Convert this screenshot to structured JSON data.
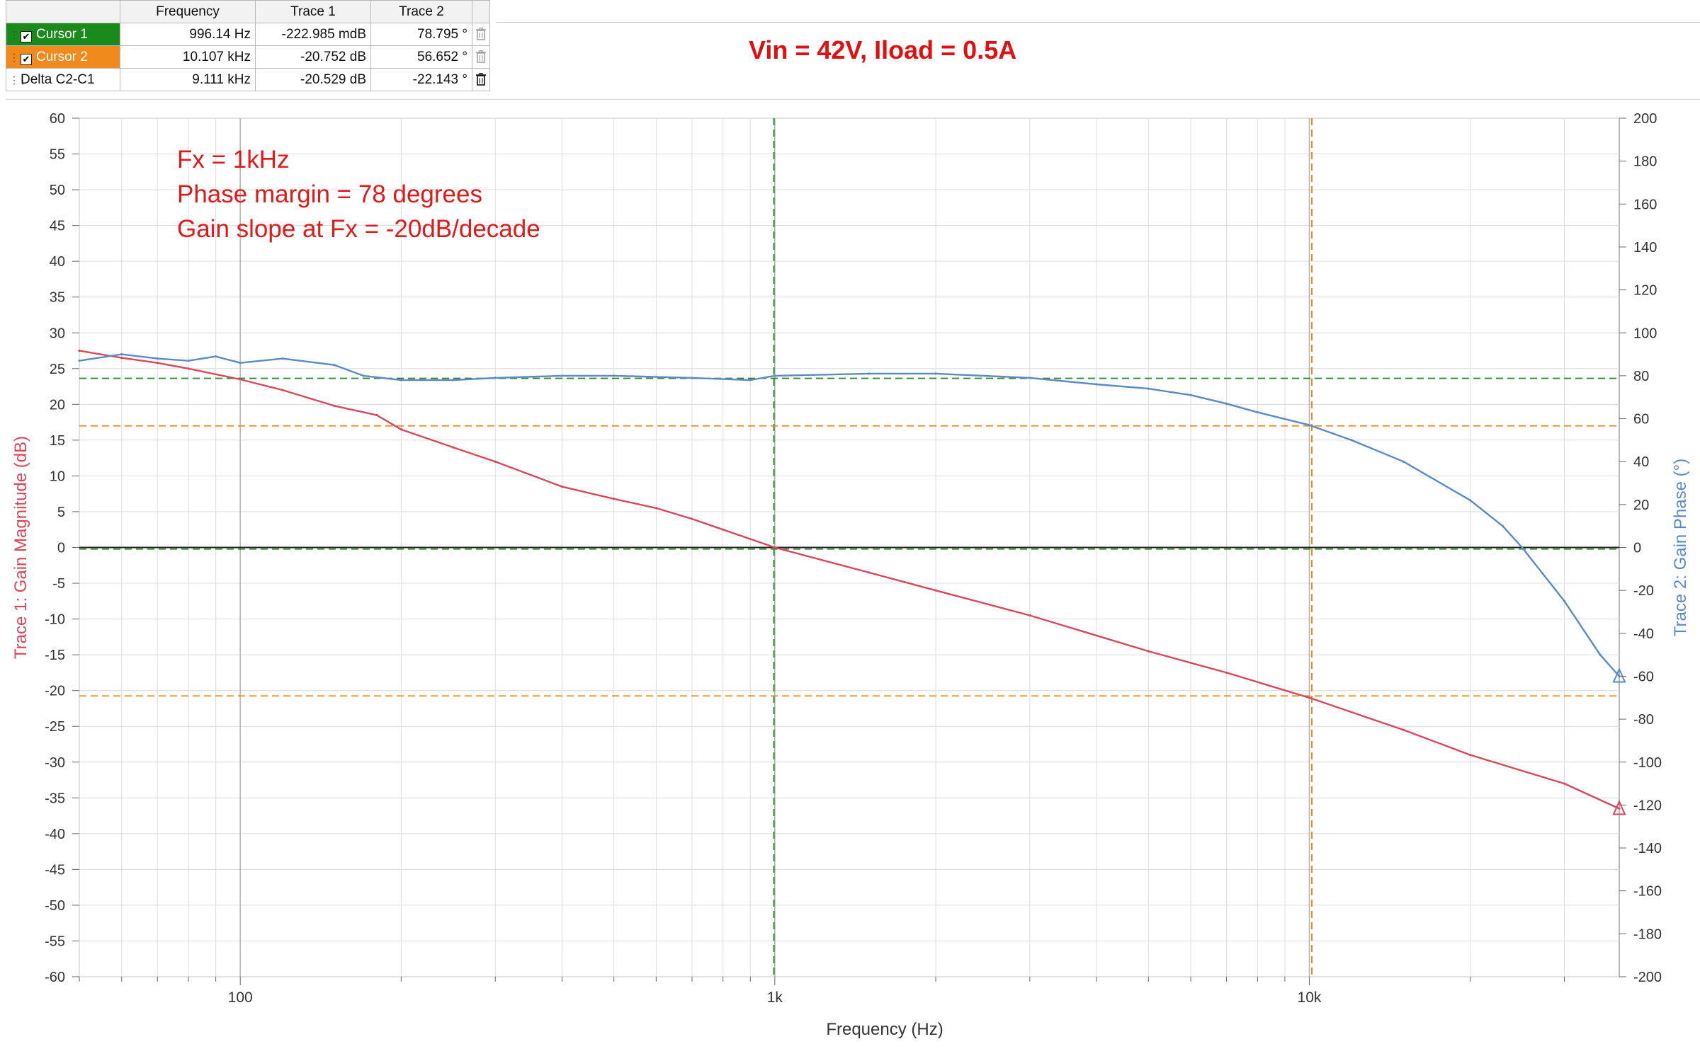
{
  "cursor_table": {
    "headers": [
      "",
      "Frequency",
      "Trace 1",
      "Trace 2",
      ""
    ],
    "rows": [
      {
        "name": "Cursor 1",
        "frequency": "996.14 Hz",
        "trace1": "-222.985 mdB",
        "trace2": "78.795 °",
        "color": "#1a8a1a",
        "checked": true
      },
      {
        "name": "Cursor 2",
        "frequency": "10.107 kHz",
        "trace1": "-20.752 dB",
        "trace2": "56.652 °",
        "color": "#f08a1c",
        "checked": true
      },
      {
        "name": "Delta C2-C1",
        "frequency": "9.111 kHz",
        "trace1": "-20.529 dB",
        "trace2": "-22.143 °",
        "color": "",
        "checked": false
      }
    ]
  },
  "title": "Vin = 42V, Iload = 0.5A",
  "chart_data": {
    "type": "line",
    "xlabel": "Frequency (Hz)",
    "ylabel_left": "Trace 1: Gain Magnitude (dB)",
    "ylabel_right": "Trace 2: Gain Phase (°)",
    "x_scale": "log",
    "xlim": [
      50,
      38000
    ],
    "ylim_left": [
      -60,
      60
    ],
    "ylim_right": [
      -200,
      200
    ],
    "y_ticks_left": [
      60,
      55,
      50,
      45,
      40,
      35,
      30,
      25,
      20,
      15,
      10,
      5,
      0,
      -5,
      -10,
      -15,
      -20,
      -25,
      -30,
      -35,
      -40,
      -45,
      -50,
      -55,
      -60
    ],
    "y_ticks_right": [
      200,
      180,
      160,
      140,
      120,
      100,
      80,
      60,
      40,
      20,
      0,
      -20,
      -40,
      -60,
      -80,
      -100,
      -120,
      -140,
      -160,
      -180,
      -200
    ],
    "x_ticks": [
      {
        "value": 100,
        "label": "100"
      },
      {
        "value": 1000,
        "label": "1k"
      },
      {
        "value": 10000,
        "label": "10k"
      }
    ],
    "grid": true,
    "annotations": [
      "Fx = 1kHz",
      "Phase margin = 78 degrees",
      "Gain slope at Fx = -20dB/decade"
    ],
    "series": [
      {
        "name": "Trace 1",
        "axis": "left",
        "color": "#d9475a",
        "x": [
          50,
          60,
          70,
          80,
          100,
          120,
          150,
          180,
          200,
          250,
          300,
          400,
          500,
          600,
          700,
          800,
          1000,
          1500,
          2000,
          3000,
          5000,
          7000,
          10000,
          15000,
          20000,
          30000,
          38000
        ],
        "y": [
          27.5,
          26.5,
          25.8,
          25,
          23.5,
          22,
          19.8,
          18.5,
          16.5,
          14,
          12,
          8.5,
          6.8,
          5.5,
          4,
          2.5,
          0,
          -3.5,
          -6,
          -9.5,
          -14.5,
          -17.5,
          -21,
          -25.5,
          -29,
          -33,
          -36.5
        ]
      },
      {
        "name": "Trace 2",
        "axis": "right",
        "color": "#5b8bc4",
        "x": [
          50,
          60,
          70,
          80,
          90,
          100,
          120,
          150,
          170,
          200,
          250,
          300,
          400,
          500,
          700,
          900,
          1000,
          1500,
          2000,
          3000,
          4000,
          5000,
          6000,
          7000,
          8000,
          10000,
          12000,
          15000,
          20000,
          23000,
          25000,
          30000,
          35000,
          38000
        ],
        "y": [
          87,
          90,
          88,
          87,
          89,
          86,
          88,
          85,
          80,
          78,
          78,
          79,
          80,
          80,
          79,
          78,
          80,
          81,
          81,
          79,
          76,
          74,
          71,
          67,
          63,
          57,
          50,
          40,
          22,
          10,
          0,
          -25,
          -50,
          -60
        ]
      }
    ],
    "cursors": [
      {
        "name": "Cursor 1",
        "x": 996.14,
        "gain": -0.223,
        "phase": 78.795,
        "color": "#2e8b2e"
      },
      {
        "name": "Cursor 2",
        "x": 10107,
        "gain": -20.752,
        "phase": 56.652,
        "color": "#f08a1c"
      }
    ]
  }
}
